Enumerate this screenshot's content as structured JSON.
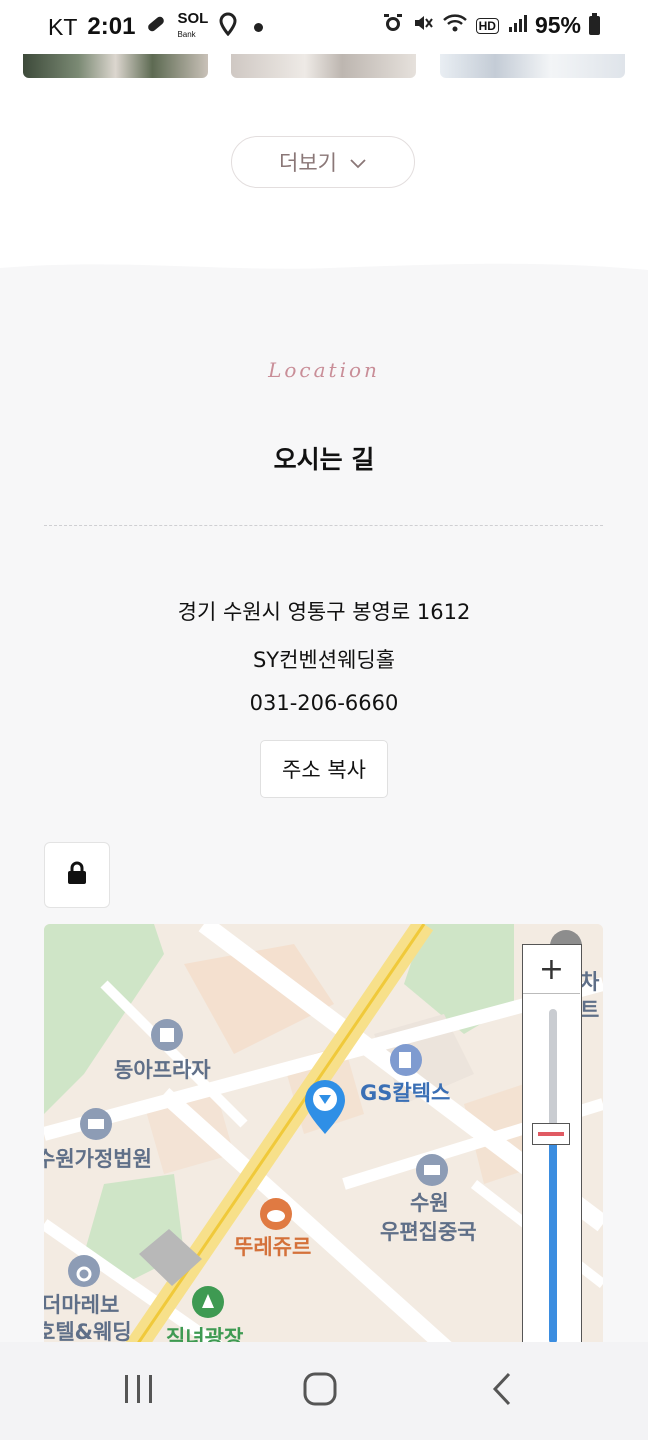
{
  "status_bar": {
    "carrier": "KT",
    "time": "2:01",
    "battery_percent": "95%",
    "icons": [
      "pill-icon",
      "sol-bank-icon",
      "location-pin-icon",
      "notification-dot",
      "alarm-icon",
      "mute-icon",
      "wifi-icon",
      "hd-icon",
      "signal-icon",
      "battery-icon"
    ]
  },
  "gallery": {
    "more_label": "더보기"
  },
  "location": {
    "script_title": "Location",
    "title": "오시는 길",
    "address": "경기 수원시 영통구 봉영로 1612",
    "venue": "SY컨벤션웨딩홀",
    "phone": "031-206-6660",
    "copy_button": "주소 복사"
  },
  "map": {
    "labels": {
      "dongah": "동아프라자",
      "gs": "GS칼텍스",
      "court": "수원가정법원",
      "post1": "수원",
      "post2": "우편집중국",
      "ttre": "뚜레쥬르",
      "hotel1": "더마레보",
      "hotel2": "호텔&웨딩",
      "square": "직녀광장",
      "corner1": "차",
      "corner2": "트"
    },
    "zoom_in_label": "+",
    "zoom_level_fraction": 0.36
  },
  "nav_bar": {
    "items": [
      "recent-apps",
      "home",
      "back"
    ]
  }
}
